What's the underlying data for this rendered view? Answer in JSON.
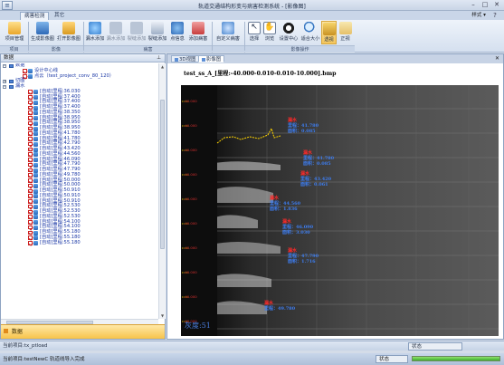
{
  "app": {
    "title": "轨道交通结构形变与病害检测系统 - [影像图]",
    "styles_label": "样式"
  },
  "tabs": [
    {
      "label": "病害检测"
    },
    {
      "label": "其它"
    }
  ],
  "ribbon": {
    "buttons": [
      {
        "label": "项目管理",
        "icon": "project-icon"
      },
      {
        "label": "生成影像图",
        "icon": "generate-image-icon"
      },
      {
        "label": "打开影像图",
        "icon": "open-image-icon"
      },
      {
        "label": "漏水添加",
        "icon": "leak-add-icon"
      },
      {
        "label": "漏水添加",
        "icon": "leak-add2-icon"
      },
      {
        "label": "裂缝添加",
        "icon": "crack-add-icon"
      },
      {
        "label": "裂缝添加",
        "icon": "crack-add2-icon"
      },
      {
        "label": "点信息",
        "icon": "point-info-icon"
      },
      {
        "label": "添加病害",
        "icon": "add-disease-icon"
      },
      {
        "label": "自定义病害",
        "icon": "custom-disease-icon"
      },
      {
        "label": "选择",
        "icon": "select-arrow-icon"
      },
      {
        "label": "浏览",
        "icon": "browse-hand-icon"
      },
      {
        "label": "设置中心",
        "icon": "settings-center-icon"
      },
      {
        "label": "适合大小",
        "icon": "fit-size-icon"
      },
      {
        "label": "透视",
        "icon": "perspective-icon"
      },
      {
        "label": "正视",
        "icon": "front-view-icon"
      }
    ],
    "groups": [
      "项目",
      "影像",
      "病害",
      "",
      "影像操作"
    ]
  },
  "left_panel": {
    "header": "数据",
    "tree": {
      "root": "数据",
      "children1": [
        "设计中心线",
        "点云（test_project_conv_80_120）"
      ],
      "nodes": [
        "切图",
        "漏水"
      ],
      "leak_items": [
        "[自动]里程:36.030",
        "[自动]里程:37.400",
        "[自动]里程:37.400",
        "[自动]里程:37.400",
        "[自动]里程:38.350",
        "[自动]里程:38.950",
        "[自动]里程:38.950",
        "[自动]里程:38.950",
        "[自动]里程:41.780",
        "[自动]里程:41.780",
        "[自动]里程:42.790",
        "[自动]里程:43.420",
        "[自动]里程:44.560",
        "[自动]里程:46.090",
        "[自动]里程:47.790",
        "[自动]里程:47.790",
        "[自动]里程:49.780",
        "[自动]里程:50.000",
        "[自动]里程:50.000",
        "[自动]里程:50.910",
        "[自动]里程:50.910",
        "[自动]里程:50.910",
        "[自动]里程:52.530",
        "[自动]里程:52.530",
        "[自动]里程:52.530",
        "[自动]里程:54.100",
        "[自动]里程:54.100",
        "[自动]里程:55.180",
        "[自动]里程:55.180",
        "[自动]里程:55.180"
      ]
    },
    "dock_label": "数据"
  },
  "right_panel": {
    "doc_tabs": [
      {
        "label": "3D视图"
      },
      {
        "label": "影像图"
      }
    ],
    "image_title": "test_ss_A_[里程:-40.000-0.010-0.010-10.000].bmp",
    "tick_labels": [
      "-40.000",
      "-40.000",
      "-40.000",
      "-40.000",
      "-40.000",
      "-40.000",
      "-40.000",
      "-40.000",
      "-40.000",
      "-40.000"
    ],
    "annotations": [
      {
        "label": "漏水",
        "lines": [
          "里程：41.780",
          "面积：0.085"
        ]
      },
      {
        "label": "漏水",
        "lines": [
          "里程：41.780",
          "面积：0.085"
        ]
      },
      {
        "label": "漏水",
        "lines": [
          "里程：43.420",
          "面积：0.061"
        ]
      },
      {
        "label": "漏水",
        "lines": [
          "里程：44.560",
          "面积：1.836"
        ]
      },
      {
        "label": "漏水",
        "lines": [
          "里程：46.090",
          "面积：3.030"
        ]
      },
      {
        "label": "漏水",
        "lines": [
          "里程：47.790",
          "面积：1.716"
        ]
      },
      {
        "label": "漏水",
        "lines": [
          "里程：49.780"
        ]
      }
    ],
    "gray_label": "灰度:51"
  },
  "status": {
    "line1": "当前项目:tx_ptload",
    "line2_project": "当前项目:testNewC",
    "line2_msg": "轨道线导入完成",
    "status_label": "状态",
    "progress": 1.0
  }
}
